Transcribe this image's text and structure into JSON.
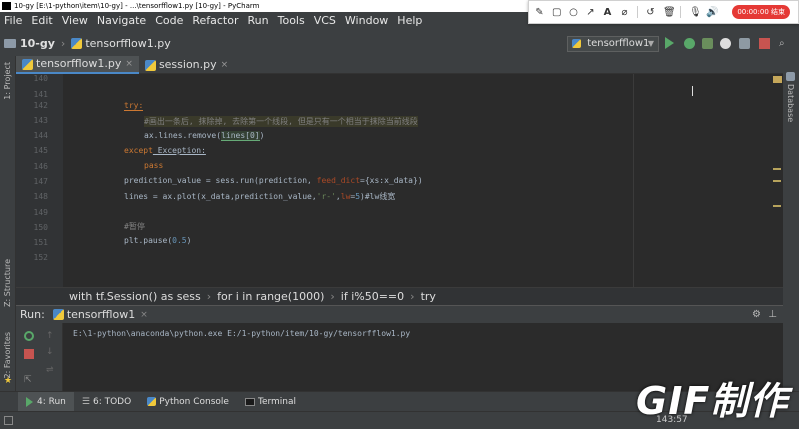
{
  "window": {
    "title": "10-gy [E:\\1-python\\item\\10-gy] - ...\\tensorfflow1.py [10-gy] - PyCharm"
  },
  "menu": [
    "File",
    "Edit",
    "View",
    "Navigate",
    "Code",
    "Refactor",
    "Run",
    "Tools",
    "VCS",
    "Window",
    "Help"
  ],
  "recorder": {
    "tools": [
      "pencil-icon",
      "rectangle-icon",
      "circle-icon",
      "arrow-icon",
      "text-icon",
      "highlighter-icon",
      "undo-icon",
      "delete-icon",
      "mic-icon",
      "speaker-icon"
    ],
    "timer": "00:00:00 结束"
  },
  "nav": {
    "project": "10-gy",
    "file": "tensorfflow1.py",
    "run_config": "tensorfflow1"
  },
  "left_strip": {
    "project": "1: Project",
    "structure": "Z: Structure",
    "favorites": "2: Favorites"
  },
  "right_strip": {
    "database": "Database"
  },
  "tabs": [
    {
      "label": "tensorfflow1.py",
      "active": true
    },
    {
      "label": "session.py",
      "active": false
    }
  ],
  "editor": {
    "line_numbers": [
      "140",
      "141",
      "142",
      "143",
      "144",
      "145",
      "146",
      "147",
      "148",
      "149",
      "150",
      "151",
      "152"
    ],
    "lines": {
      "l142_kw": "try:",
      "l143": "#画出一条后, 抹除掉, 去除第一个线段, 但是只有一个相当于抹除当前线段",
      "l144_a": "ax.lines.remove(",
      "l144_b": "lines[0]",
      "l144_c": ")",
      "l145_kw": "except",
      "l145_b": " Exception:",
      "l146_kw": "pass",
      "l147_a": "prediction_value = sess.run(prediction, ",
      "l147_b": "feed_dict",
      "l147_c": "={xs:x_data})",
      "l148_a": "lines = ax.plot(x_data,prediction_value,",
      "l148_b": "'r-'",
      "l148_c": ",",
      "l148_d": "lw",
      "l148_e": "=",
      "l148_f": "5",
      "l148_g": ")#lw线宽",
      "l150": "#暂停",
      "l151_a": "plt.pause(",
      "l151_b": "0.5",
      "l151_c": ")"
    }
  },
  "breadcrumb": [
    "with tf.Session() as sess",
    "for i in range(1000)",
    "if i%50==0",
    "try"
  ],
  "run_panel": {
    "label": "Run:",
    "tab": "tensorfflow1",
    "console_line": "E:\\1-python\\anaconda\\python.exe E:/1-python/item/10-gy/tensorfflow1.py"
  },
  "bottom_tabs": [
    {
      "label": "4: Run",
      "active": true
    },
    {
      "label": "6: TODO",
      "active": false
    },
    {
      "label": "Python Console",
      "active": false
    },
    {
      "label": "Terminal",
      "active": false
    }
  ],
  "status": {
    "position": "143:57"
  },
  "watermark": "GIF制作"
}
